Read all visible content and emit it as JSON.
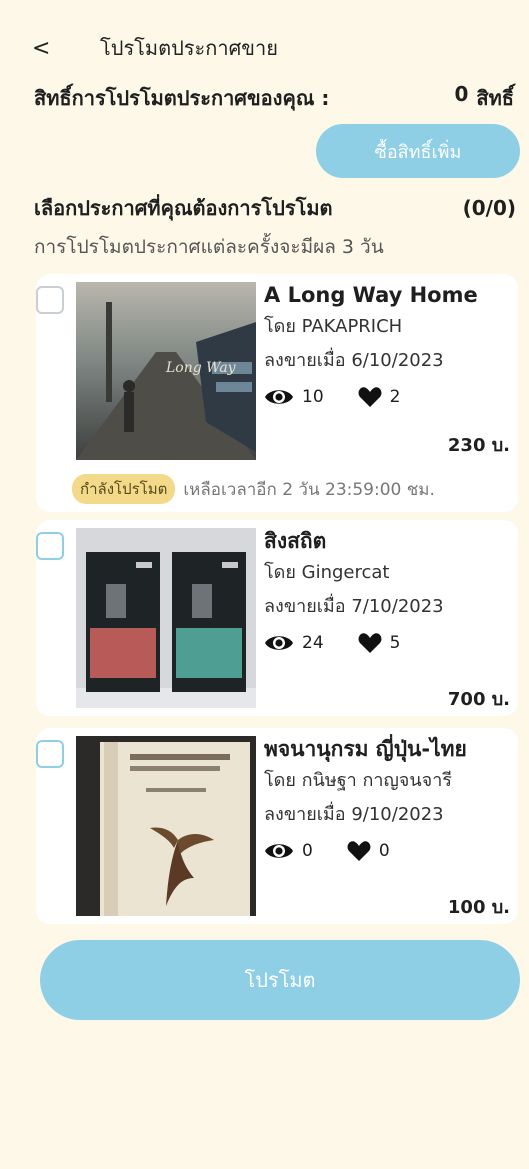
{
  "header": {
    "back_icon": "chevron-left-icon",
    "back_glyph": "<",
    "title": "โปรโมตประกาศขาย"
  },
  "rights": {
    "label": "สิทธิ์การโปรโมตประกาศของคุณ :",
    "count": "0",
    "unit": "สิทธิ์"
  },
  "buy_button_label": "ซื้อสิทธิ์เพิ่ม",
  "selection": {
    "label": "เลือกประกาศที่คุณต้องการโปรโมต",
    "count": "(0/0)",
    "note": "การโปรโมตประกาศแต่ละครั้งจะมีผล 3 วัน"
  },
  "books": [
    {
      "title": "A Long Way Home",
      "by": "โดย PAKAPRICH",
      "listed": "ลงขายเมื่อ 6/10/2023",
      "views": "10",
      "likes": "2",
      "price": "230 บ.",
      "promo_badge": "กำลังโปรโมต",
      "promo_remaining": "เหลือเวลาอีก 2 วัน 23:59:00 ชม."
    },
    {
      "title": "สิงสถิต",
      "by": "โดย  Gingercat",
      "listed": "ลงขายเมื่อ 7/10/2023",
      "views": "24",
      "likes": "5",
      "price": "700 บ."
    },
    {
      "title": "พจนานุกรม ญี่ปุ่น-ไทย",
      "by": "โดย  กนิษฐา กาญจนจารี",
      "listed": "ลงขายเมื่อ 9/10/2023",
      "views": "0",
      "likes": "0",
      "price": "100 บ."
    }
  ],
  "icons": {
    "views": "eye-icon",
    "likes": "heart-icon"
  },
  "promote_button_label": "โปรโมต",
  "colors": {
    "background": "#fdf8e8",
    "accent": "#8ecfe6",
    "badge": "#f3d98a"
  }
}
